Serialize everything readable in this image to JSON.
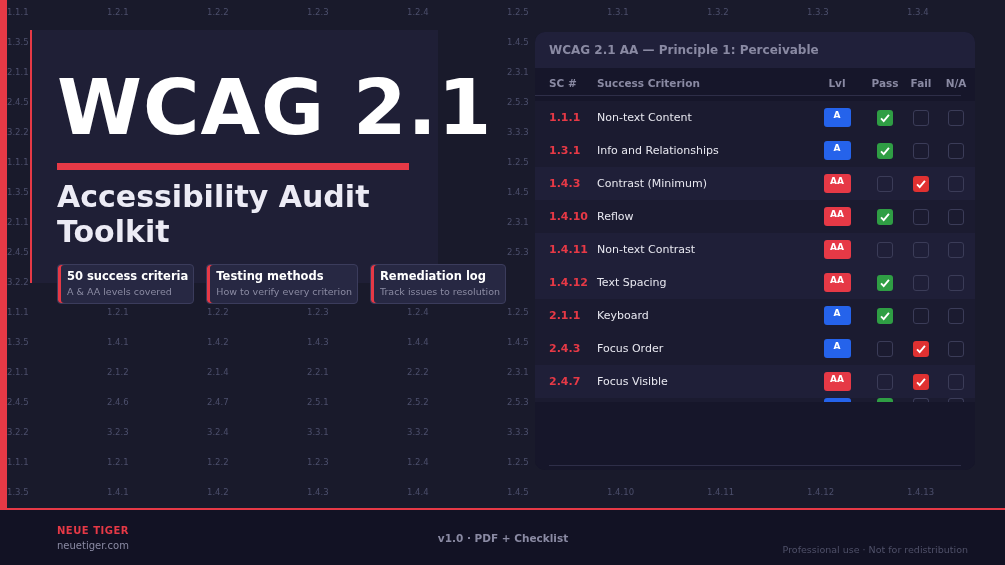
{
  "code_grid": {
    "rows": [
      {
        "kind": "full",
        "cells": [
          "1.1.1",
          "1.2.1",
          "1.2.2",
          "1.2.3",
          "1.2.4",
          "1.2.5",
          "1.3.1",
          "1.3.2",
          "1.3.3",
          "1.3.4"
        ]
      },
      {
        "kind": "edges",
        "cells": [
          "1.3.5",
          "1.4.5"
        ]
      },
      {
        "kind": "edges",
        "cells": [
          "2.1.1",
          "2.3.1"
        ]
      },
      {
        "kind": "edges",
        "cells": [
          "2.4.5",
          "2.5.3"
        ]
      },
      {
        "kind": "edges",
        "cells": [
          "3.2.2",
          "3.3.3"
        ]
      },
      {
        "kind": "edges",
        "cells": [
          "1.1.1",
          "1.2.5"
        ]
      },
      {
        "kind": "edges",
        "cells": [
          "1.3.5",
          "1.4.5"
        ]
      },
      {
        "kind": "edges",
        "cells": [
          "2.1.1",
          "2.3.1"
        ]
      },
      {
        "kind": "edges",
        "cells": [
          "2.4.5",
          "2.5.3"
        ]
      },
      {
        "kind": "left",
        "cells": [
          "3.2.2"
        ]
      },
      {
        "kind": "half",
        "cells": [
          "1.1.1",
          "1.2.1",
          "1.2.2",
          "1.2.3",
          "1.2.4",
          "1.2.5"
        ]
      },
      {
        "kind": "half",
        "cells": [
          "1.3.5",
          "1.4.1",
          "1.4.2",
          "1.4.3",
          "1.4.4",
          "1.4.5"
        ]
      },
      {
        "kind": "half",
        "cells": [
          "2.1.1",
          "2.1.2",
          "2.1.4",
          "2.2.1",
          "2.2.2",
          "2.3.1"
        ]
      },
      {
        "kind": "half",
        "cells": [
          "2.4.5",
          "2.4.6",
          "2.4.7",
          "2.5.1",
          "2.5.2",
          "2.5.3"
        ]
      },
      {
        "kind": "half",
        "cells": [
          "3.2.2",
          "3.2.3",
          "3.2.4",
          "3.3.1",
          "3.3.2",
          "3.3.3"
        ]
      },
      {
        "kind": "half",
        "cells": [
          "1.1.1",
          "1.2.1",
          "1.2.2",
          "1.2.3",
          "1.2.4",
          "1.2.5"
        ]
      },
      {
        "kind": "full",
        "cells": [
          "1.3.5",
          "1.4.1",
          "1.4.2",
          "1.4.3",
          "1.4.4",
          "1.4.5",
          "1.4.10",
          "1.4.11",
          "1.4.12",
          "1.4.13"
        ]
      }
    ]
  },
  "hero": {
    "title": "WCAG 2.1",
    "subtitle": "Accessibility Audit Toolkit"
  },
  "features": [
    {
      "title": "50 success criteria",
      "text": "A & AA levels covered"
    },
    {
      "title": "Testing methods",
      "text": "How to verify every criterion"
    },
    {
      "title": "Remediation log",
      "text": "Track issues to resolution"
    }
  ],
  "checklist": {
    "title": "WCAG 2.1 AA — Principle 1: Perceivable",
    "columns": [
      "SC #",
      "Success Criterion",
      "Lvl",
      "Pass",
      "Fail",
      "N/A"
    ],
    "rows": [
      {
        "sc": "1.1.1",
        "name": "Non-text Content",
        "level": "A",
        "kind": "single",
        "pass": true,
        "fail": false,
        "na": false
      },
      {
        "sc": "1.3.1",
        "name": "Info and Relationships",
        "level": "A",
        "kind": "single",
        "pass": true,
        "fail": false,
        "na": false
      },
      {
        "sc": "1.4.3",
        "name": "Contrast (Minimum)",
        "level": "AA",
        "kind": "double",
        "pass": false,
        "fail": true,
        "na": false
      },
      {
        "sc": "1.4.10",
        "name": "Reflow",
        "level": "AA",
        "kind": "double",
        "pass": true,
        "fail": false,
        "na": false
      },
      {
        "sc": "1.4.11",
        "name": "Non-text Contrast",
        "level": "AA",
        "kind": "double",
        "pass": false,
        "fail": false,
        "na": false
      },
      {
        "sc": "1.4.12",
        "name": "Text Spacing",
        "level": "AA",
        "kind": "double",
        "pass": true,
        "fail": false,
        "na": false
      },
      {
        "sc": "2.1.1",
        "name": "Keyboard",
        "level": "A",
        "kind": "single",
        "pass": true,
        "fail": false,
        "na": false
      },
      {
        "sc": "2.4.3",
        "name": "Focus Order",
        "level": "A",
        "kind": "single",
        "pass": false,
        "fail": true,
        "na": false
      },
      {
        "sc": "2.4.7",
        "name": "Focus Visible",
        "level": "AA",
        "kind": "double",
        "pass": false,
        "fail": true,
        "na": false
      }
    ],
    "cut_row": {
      "kind": "single",
      "pass": true,
      "fail": false,
      "na": false
    }
  },
  "footer": {
    "brand": "NEUE TIGER",
    "site": "neuetiger.com",
    "version": "v1.0 · PDF + Checklist",
    "notice": "Professional use · Not for redistribution"
  }
}
